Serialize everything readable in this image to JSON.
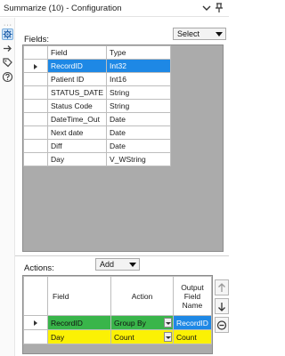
{
  "window": {
    "title": "Summarize (10) - Configuration"
  },
  "fields_section": {
    "label": "Fields:",
    "select_button": "Select",
    "columns": [
      "Field",
      "Type"
    ],
    "rows": [
      {
        "field": "RecordID",
        "type": "Int32",
        "selected": true
      },
      {
        "field": "Patient ID",
        "type": "Int16"
      },
      {
        "field": "STATUS_DATE",
        "type": "String"
      },
      {
        "field": "Status Code",
        "type": "String"
      },
      {
        "field": "DateTime_Out",
        "type": "Date"
      },
      {
        "field": "Next date",
        "type": "Date"
      },
      {
        "field": "Diff",
        "type": "Date"
      },
      {
        "field": "Day",
        "type": "V_WString"
      }
    ]
  },
  "actions_section": {
    "label": "Actions:",
    "add_button": "Add",
    "columns": [
      "Field",
      "Action",
      "Output Field Name"
    ],
    "rows": [
      {
        "field": "RecordID",
        "action": "Group By",
        "output": "RecordID"
      },
      {
        "field": "Day",
        "action": "Count",
        "output": "Count"
      }
    ]
  },
  "colors": {
    "selection": "#1e88e5",
    "highlight_green": "#39b54a",
    "highlight_yellow": "#fbf104",
    "grid_background": "#ababab"
  },
  "icons": [
    "chevron-down-icon",
    "pin-icon",
    "settings-icon",
    "arrow-icon",
    "tag-icon",
    "help-icon",
    "row-pointer-icon",
    "move-up-icon",
    "move-down-icon",
    "remove-icon"
  ]
}
